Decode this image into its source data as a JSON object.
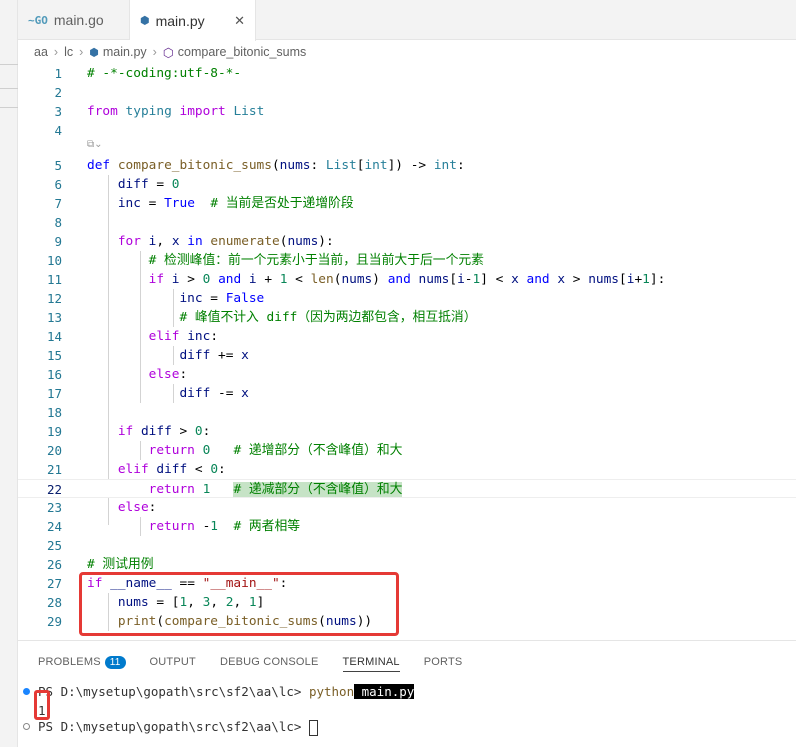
{
  "tabs": [
    {
      "icon": "go-file-icon",
      "label": "main.go",
      "active": false
    },
    {
      "icon": "python-file-icon",
      "label": "main.py",
      "active": true
    }
  ],
  "breadcrumb": {
    "parts": [
      "aa",
      "lc",
      "main.py",
      "compare_bitonic_sums"
    ]
  },
  "editor": {
    "current_line": 22,
    "line_numbers": [
      "1",
      "2",
      "3",
      "4",
      "5",
      "6",
      "7",
      "8",
      "9",
      "10",
      "11",
      "12",
      "13",
      "14",
      "15",
      "16",
      "17",
      "18",
      "19",
      "20",
      "21",
      "22",
      "23",
      "24",
      "25",
      "26",
      "27",
      "28",
      "29"
    ]
  },
  "panel": {
    "tabs": [
      "PROBLEMS",
      "OUTPUT",
      "DEBUG CONSOLE",
      "TERMINAL",
      "PORTS"
    ],
    "problems_count": "11",
    "active_tab": "TERMINAL",
    "terminal": {
      "prompt1": "PS D:\\mysetup\\gopath\\src\\sf2\\aa\\lc> ",
      "cmd_python": "python",
      "cmd_arg": " main.py",
      "output": "1",
      "prompt2": "PS D:\\mysetup\\gopath\\src\\sf2\\aa\\lc> "
    }
  },
  "colors": {
    "accent": "#007acc",
    "annotation_red": "#e53935"
  }
}
